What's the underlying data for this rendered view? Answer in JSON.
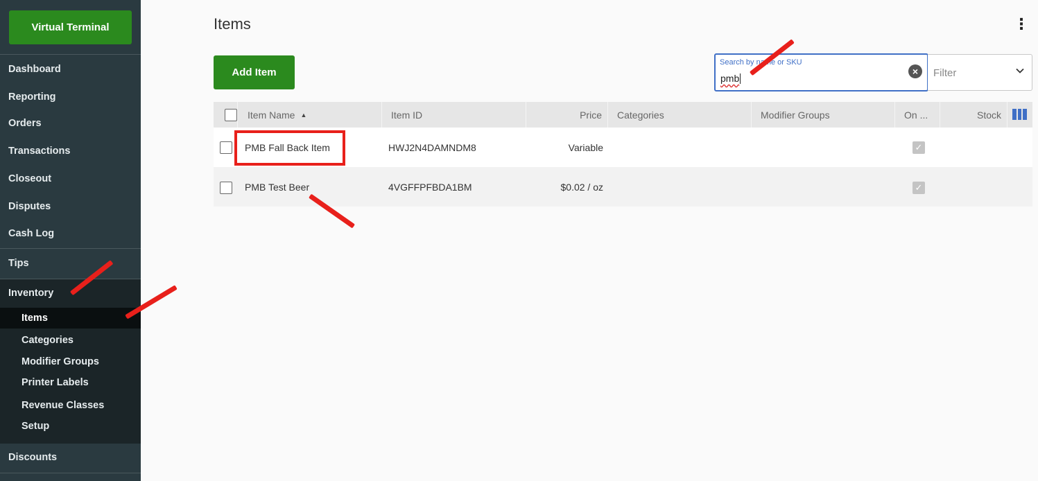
{
  "sidebar": {
    "virtual_terminal": "Virtual Terminal",
    "nav": [
      {
        "label": "Dashboard"
      },
      {
        "label": "Reporting"
      },
      {
        "label": "Orders"
      },
      {
        "label": "Transactions"
      },
      {
        "label": "Closeout"
      },
      {
        "label": "Disputes"
      },
      {
        "label": "Cash Log"
      },
      {
        "label": "Tips"
      },
      {
        "label": "Inventory"
      }
    ],
    "inventory_sub": [
      {
        "label": "Items",
        "active": true
      },
      {
        "label": "Categories"
      },
      {
        "label": "Modifier Groups"
      },
      {
        "label": "Printer Labels"
      },
      {
        "label": "Revenue Classes"
      },
      {
        "label": "Setup"
      }
    ],
    "after": [
      {
        "label": "Discounts"
      }
    ]
  },
  "header": {
    "title": "Items",
    "kebab_icon": "kebab-menu-icon"
  },
  "toolbar": {
    "add_item_label": "Add Item",
    "search_label": "Search by name or SKU",
    "search_value": "pmb",
    "filter_placeholder": "Filter"
  },
  "table": {
    "columns": [
      "Item Name",
      "Item ID",
      "Price",
      "Categories",
      "Modifier Groups",
      "On ...",
      "Stock"
    ],
    "rows": [
      {
        "name": "PMB Fall Back Item",
        "id": "HWJ2N4DAMNDM8",
        "price": "Variable",
        "categories": "",
        "modifier_groups": "",
        "on": true,
        "stock": ""
      },
      {
        "name": "PMB Test Beer",
        "id": "4VGFFPFBDA1BM",
        "price": "$0.02 / oz",
        "categories": "",
        "modifier_groups": "",
        "on": true,
        "stock": ""
      }
    ]
  },
  "colors": {
    "brand_green": "#2b8a1e",
    "sidebar_bg": "#2a3a40",
    "accent_blue": "#3f6fc6",
    "annotation_red": "#e8201b"
  }
}
